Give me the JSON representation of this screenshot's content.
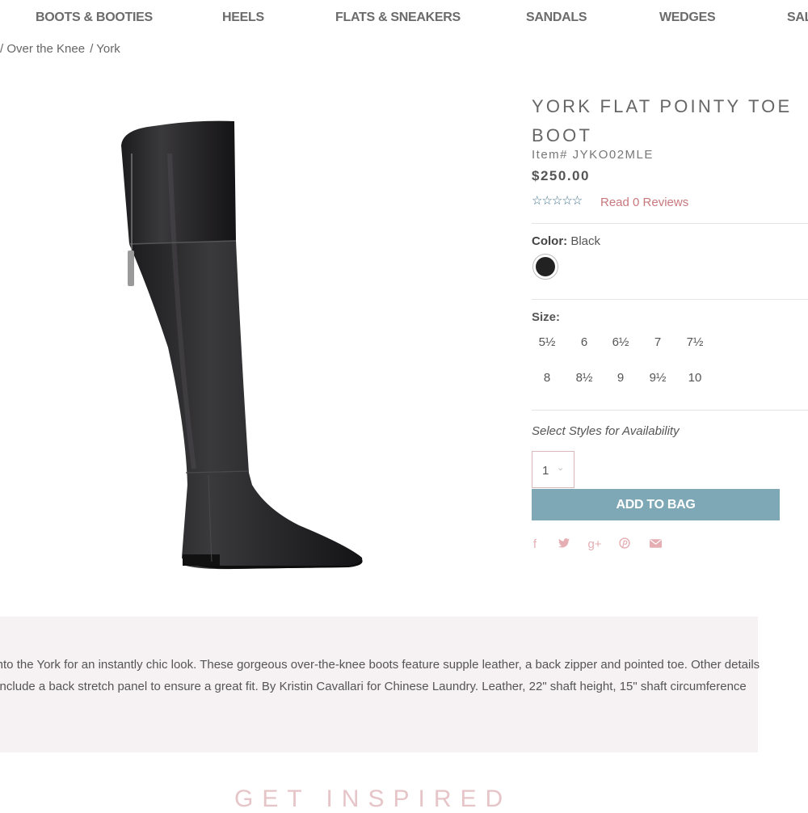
{
  "nav": {
    "items": [
      "BOOTS & BOOTIES",
      "HEELS",
      "FLATS & SNEAKERS",
      "SANDALS",
      "WEDGES",
      "SALE"
    ]
  },
  "breadcrumb": [
    "/ Over the Knee",
    "/ York"
  ],
  "product": {
    "title": "YORK FLAT POINTY TOE BOOT",
    "item_number": "Item# JYKO02MLE",
    "price": "$250.00",
    "stars": "☆☆☆☆☆",
    "rating": 0,
    "reviews_link": "Read 0 Reviews",
    "color_label": "Color:",
    "color_value": "Black",
    "swatch_color": "#222222",
    "size_label": "Size:",
    "sizes": [
      "5½",
      "6",
      "6½",
      "7",
      "7½",
      "8",
      "8½",
      "9",
      "9½",
      "10"
    ],
    "availability_label": "Select Styles for Availability",
    "quantity": "1",
    "add_to_bag": "ADD TO BAG",
    "share_icons": [
      "facebook-icon",
      "twitter-icon",
      "google-plus-icon",
      "pinterest-icon",
      "email-icon"
    ]
  },
  "description": "p into the York for an instantly chic look. These gorgeous over-the-knee boots feature supple leather, a back zipper and pointed toe. Other details include a back stretch panel to ensure a great fit. By Kristin Cavallari for Chinese Laundry. Leather, 22\" shaft height, 15\" shaft circumference",
  "section_heading": "GET INSPIRED",
  "colors": {
    "accent_button": "#7ea8b5",
    "link_pink": "#c9787d",
    "description_bg": "#f6f1f2",
    "heading_pink": "#e6c5c8"
  }
}
